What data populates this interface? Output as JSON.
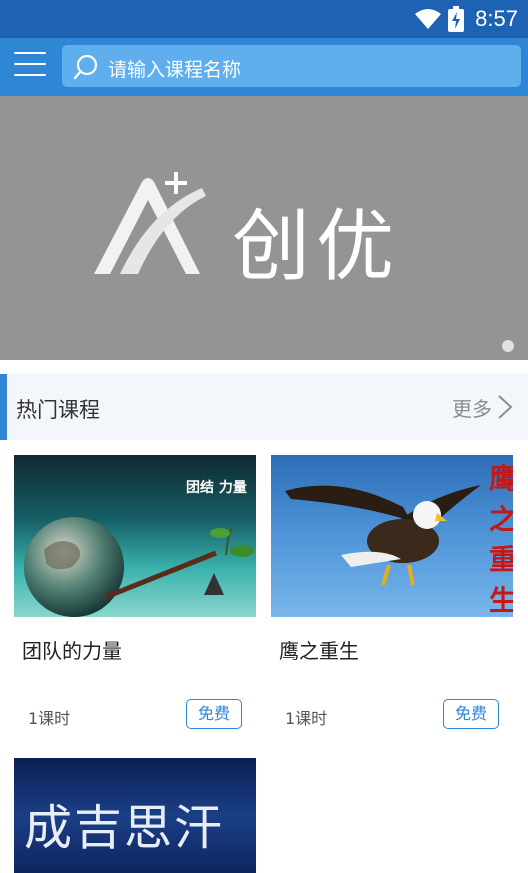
{
  "status_bar": {
    "time": "8:57"
  },
  "header": {
    "search_placeholder": "请输入课程名称"
  },
  "banner": {
    "logo_text": "创优"
  },
  "section": {
    "title": "热门课程",
    "more_label": "更多"
  },
  "courses": [
    {
      "title": "团队的力量",
      "lessons": "1课时",
      "badge": "免费",
      "thumb_text": "团结 力量"
    },
    {
      "title": "鹰之重生",
      "lessons": "1课时",
      "badge": "免费",
      "thumb_text": "鹰之重生"
    },
    {
      "title": "",
      "lessons": "",
      "badge": "",
      "thumb_text": "成吉思汗"
    }
  ],
  "colors": {
    "primary": "#2f86d4",
    "status_bar": "#1e63b3",
    "banner_bg": "#949494"
  }
}
